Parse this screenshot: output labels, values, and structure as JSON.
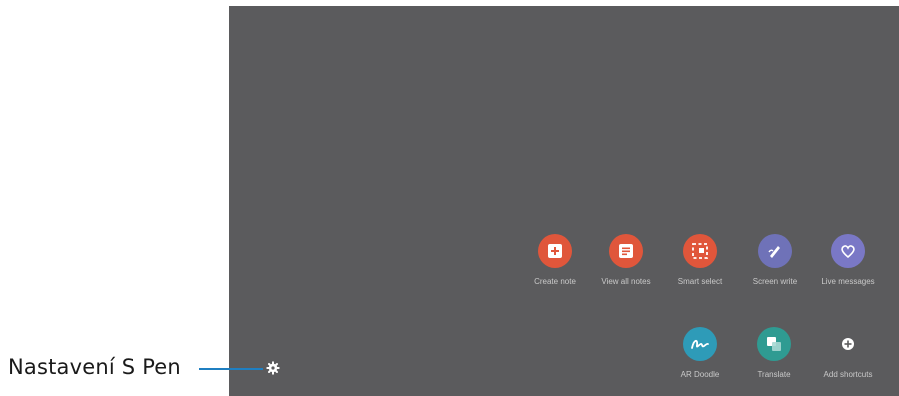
{
  "callout": {
    "label": "Nastavení S Pen",
    "accent_color": "#1f7fc1",
    "icon": "gear-icon"
  },
  "screen": {
    "background": "#5b5b5d"
  },
  "shortcuts_row1": [
    {
      "label": "Create note",
      "icon": "create-note-icon",
      "color": "#e0563b"
    },
    {
      "label": "View all notes",
      "icon": "notes-icon",
      "color": "#e0563b"
    },
    {
      "label": "Smart select",
      "icon": "smart-select-icon",
      "color": "#e0563b"
    },
    {
      "label": "Screen write",
      "icon": "screen-write-icon",
      "color": "#6f72b8"
    },
    {
      "label": "Live messages",
      "icon": "heart-icon",
      "color": "#7a78c6"
    }
  ],
  "shortcuts_row2": [
    {
      "label": "AR Doodle",
      "icon": "doodle-icon",
      "color": "#2e9bb8"
    },
    {
      "label": "Translate",
      "icon": "translate-icon",
      "color": "#2f9b92"
    },
    {
      "label": "Add shortcuts",
      "icon": "add-icon",
      "color": "#ffffff"
    }
  ]
}
